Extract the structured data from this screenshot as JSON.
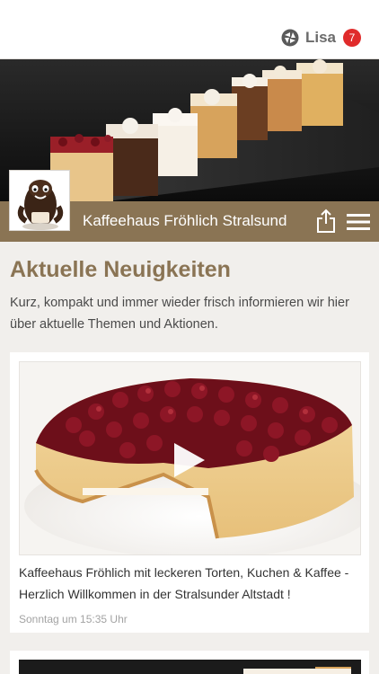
{
  "header": {
    "user_name": "Lisa",
    "notification_count": "7",
    "logo_icon": "app-logo-icon",
    "badge_color": "#e02b2b"
  },
  "titlebar": {
    "title": "Kaffeehaus Fröhlich Stralsund",
    "share_icon": "share-icon",
    "menu_icon": "hamburger-menu-icon",
    "color": "#8a7454"
  },
  "main": {
    "section_title": "Aktuelle Neuigkeiten",
    "intro": "Kurz, kompakt und immer wieder frisch informieren wir hier über aktuelle Themen und Aktionen."
  },
  "posts": [
    {
      "text": "Kaffeehaus Fröhlich mit leckeren Torten, Kuchen & Kaffee - Herzlich Willkommen in der Stralsunder Altstadt !",
      "time": "Sonntag um 15:35 Uhr",
      "media_icon": "play-icon"
    }
  ]
}
